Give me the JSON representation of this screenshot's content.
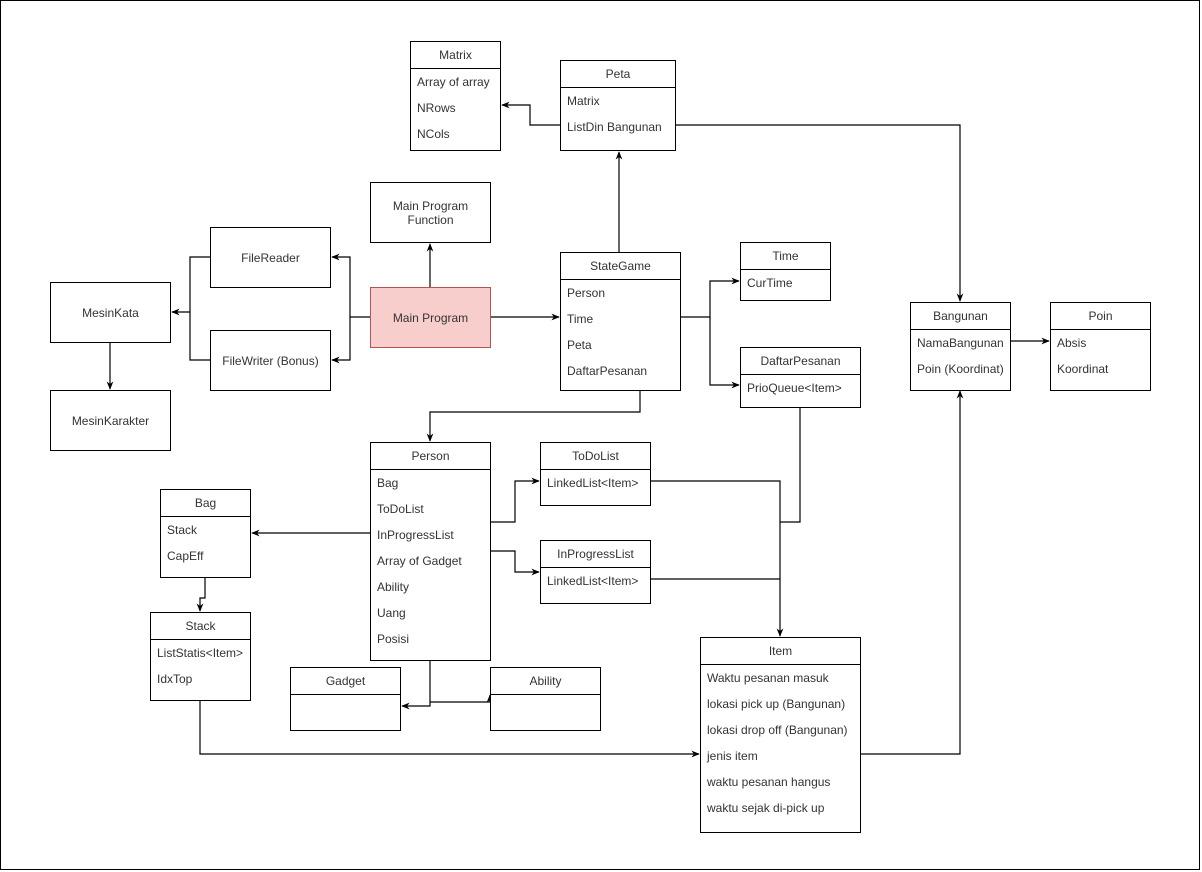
{
  "diagram": {
    "type": "class-diagram",
    "nodes": {
      "matrix": {
        "title": "Matrix",
        "fields": [
          "Array of array",
          "NRows",
          "NCols"
        ]
      },
      "peta": {
        "title": "Peta",
        "fields": [
          "Matrix",
          "ListDin Bangunan"
        ]
      },
      "main_program_function": {
        "label": "Main Program Function"
      },
      "file_reader": {
        "label": "FileReader"
      },
      "file_writer": {
        "label": "FileWriter (Bonus)"
      },
      "mesin_kata": {
        "label": "MesinKata"
      },
      "mesin_karakter": {
        "label": "MesinKarakter"
      },
      "main_program": {
        "label": "Main Program"
      },
      "state_game": {
        "title": "StateGame",
        "fields": [
          "Person",
          "Time",
          "Peta",
          "DaftarPesanan"
        ]
      },
      "time": {
        "title": "Time",
        "fields": [
          "CurTime"
        ]
      },
      "daftar_pesanan": {
        "title": "DaftarPesanan",
        "fields": [
          "PrioQueue<Item>"
        ]
      },
      "bangunan": {
        "title": "Bangunan",
        "fields": [
          "NamaBangunan",
          "Poin (Koordinat)"
        ]
      },
      "poin": {
        "title": "Poin",
        "fields": [
          "Absis",
          "Koordinat"
        ]
      },
      "person": {
        "title": "Person",
        "fields": [
          "Bag",
          "ToDoList",
          "InProgressList",
          "Array of Gadget",
          "Ability",
          "Uang",
          "Posisi"
        ]
      },
      "todo_list": {
        "title": "ToDoList",
        "fields": [
          "LinkedList<Item>"
        ]
      },
      "in_progress_list": {
        "title": "InProgressList",
        "fields": [
          "LinkedList<Item>"
        ]
      },
      "bag": {
        "title": "Bag",
        "fields": [
          "Stack",
          "CapEff"
        ]
      },
      "stack": {
        "title": "Stack",
        "fields": [
          "ListStatis<Item>",
          "IdxTop"
        ]
      },
      "gadget": {
        "title": "Gadget",
        "fields": []
      },
      "ability": {
        "title": "Ability",
        "fields": []
      },
      "item": {
        "title": "Item",
        "fields": [
          "Waktu pesanan masuk",
          "lokasi pick up (Bangunan)",
          "lokasi drop off (Bangunan)",
          "jenis item",
          "waktu pesanan hangus",
          "waktu sejak di-pick up"
        ]
      }
    },
    "edges": [
      {
        "from": "peta",
        "to": "matrix"
      },
      {
        "from": "peta",
        "to": "bangunan"
      },
      {
        "from": "state_game",
        "to": "peta"
      },
      {
        "from": "main_program",
        "to": "main_program_function"
      },
      {
        "from": "main_program",
        "to": "file_reader"
      },
      {
        "from": "main_program",
        "to": "file_writer"
      },
      {
        "from": "file_reader",
        "to": "mesin_kata"
      },
      {
        "from": "file_writer",
        "to": "mesin_kata"
      },
      {
        "from": "mesin_kata",
        "to": "mesin_karakter"
      },
      {
        "from": "main_program",
        "to": "state_game"
      },
      {
        "from": "state_game",
        "to": "time"
      },
      {
        "from": "state_game",
        "to": "daftar_pesanan"
      },
      {
        "from": "state_game",
        "to": "person"
      },
      {
        "from": "bangunan",
        "to": "poin"
      },
      {
        "from": "person",
        "to": "bag"
      },
      {
        "from": "person",
        "to": "todo_list"
      },
      {
        "from": "person",
        "to": "in_progress_list"
      },
      {
        "from": "person",
        "to": "gadget"
      },
      {
        "from": "person",
        "to": "ability"
      },
      {
        "from": "bag",
        "to": "stack"
      },
      {
        "from": "todo_list",
        "to": "item"
      },
      {
        "from": "in_progress_list",
        "to": "item"
      },
      {
        "from": "daftar_pesanan",
        "to": "item"
      },
      {
        "from": "stack",
        "to": "item"
      },
      {
        "from": "item",
        "to": "bangunan"
      }
    ]
  },
  "colors": {
    "highlight_fill": "#f8cecc",
    "highlight_stroke": "#b85450",
    "line": "#000000",
    "text": "#333333"
  }
}
